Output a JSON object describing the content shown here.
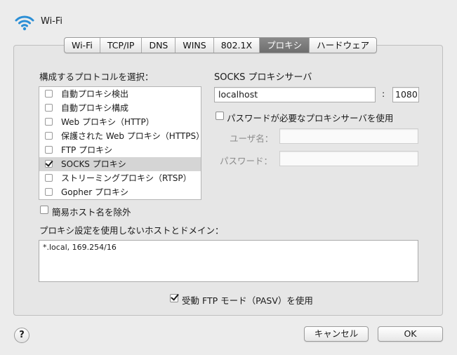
{
  "header": {
    "title": "Wi-Fi",
    "icon": "wifi-icon"
  },
  "tabs": [
    {
      "label": "Wi-Fi",
      "active": false
    },
    {
      "label": "TCP/IP",
      "active": false
    },
    {
      "label": "DNS",
      "active": false
    },
    {
      "label": "WINS",
      "active": false
    },
    {
      "label": "802.1X",
      "active": false
    },
    {
      "label": "プロキシ",
      "active": true
    },
    {
      "label": "ハードウェア",
      "active": false
    }
  ],
  "protocols": {
    "heading": "構成するプロトコルを選択：",
    "items": [
      {
        "label": "自動プロキシ検出",
        "checked": false,
        "selected": false
      },
      {
        "label": "自動プロキシ構成",
        "checked": false,
        "selected": false
      },
      {
        "label": "Web プロキシ（HTTP）",
        "checked": false,
        "selected": false
      },
      {
        "label": "保護された Web プロキシ（HTTPS）",
        "checked": false,
        "selected": false
      },
      {
        "label": "FTP プロキシ",
        "checked": false,
        "selected": false
      },
      {
        "label": "SOCKS プロキシ",
        "checked": true,
        "selected": true
      },
      {
        "label": "ストリーミングプロキシ（RTSP）",
        "checked": false,
        "selected": false
      },
      {
        "label": "Gopher プロキシ",
        "checked": false,
        "selected": false
      }
    ]
  },
  "server": {
    "heading": "SOCKS プロキシサーバ",
    "host": "localhost",
    "separator": ":",
    "port": "1080",
    "password_required_label": "パスワードが必要なプロキシサーバを使用",
    "password_required_checked": false,
    "username_label": "ユーザ名：",
    "username_value": "",
    "password_label": "パスワード：",
    "password_value": ""
  },
  "exclude_simple": {
    "label": "簡易ホスト名を除外",
    "checked": false
  },
  "bypass": {
    "heading": "プロキシ設定を使用しないホストとドメイン：",
    "value": "*.local, 169.254/16"
  },
  "passive_ftp": {
    "label": "受動 FTP モード（PASV）を使用",
    "checked": true
  },
  "footer": {
    "help_label": "?",
    "cancel_label": "キャンセル",
    "ok_label": "OK"
  },
  "colors": {
    "selected_row": "#d5d5d5",
    "active_tab": "#7a7a7a",
    "wifi_blue": "#2b8fd6"
  }
}
